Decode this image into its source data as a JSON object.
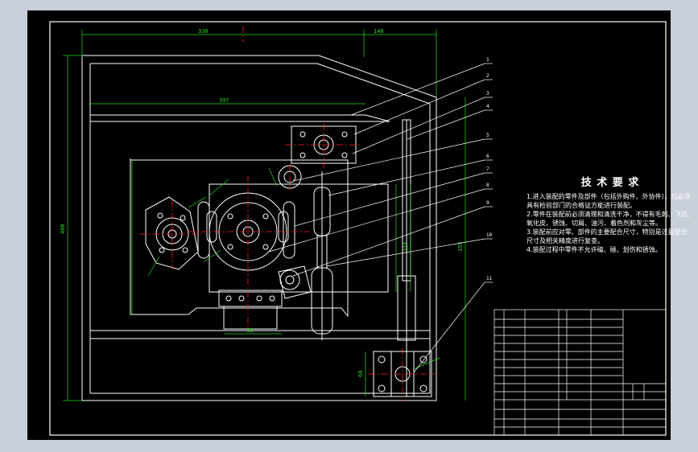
{
  "tech_requirements": {
    "title": "技 术 要 求",
    "lines": [
      "1.进入装配的零件及部件（包括外购件、外协件），均必须",
      "具有检验部门的合格证方能进行装配。",
      "2.零件在装配前必须清理和清洗干净，不得有毛刺、飞边、",
      "氧化皮、锈蚀、切屑、油污、着色剂和灰尘等。",
      "3.装配前应对零、部件的主要配合尺寸，特别是过盈配合",
      "尺寸及相关精度进行复查。",
      "4.装配过程中零件不允许磕、碰、划伤和锈蚀。"
    ]
  },
  "dimensions": {
    "top_left": "330",
    "top_right": "140",
    "mid_width": "397",
    "overall_height": "400",
    "small_width": "80",
    "right_height": "155",
    "inner_height": "215",
    "base_height": "60"
  },
  "balloons": [
    "1",
    "2",
    "3",
    "4",
    "5",
    "6",
    "7",
    "8",
    "9",
    "10",
    "11"
  ],
  "colors": {
    "sheet": "#000000",
    "background": "#c8cfd8",
    "outline": "#ffffff",
    "dimension": "#00ff00",
    "centerline": "#ff0000",
    "leader": "#ffffff"
  }
}
